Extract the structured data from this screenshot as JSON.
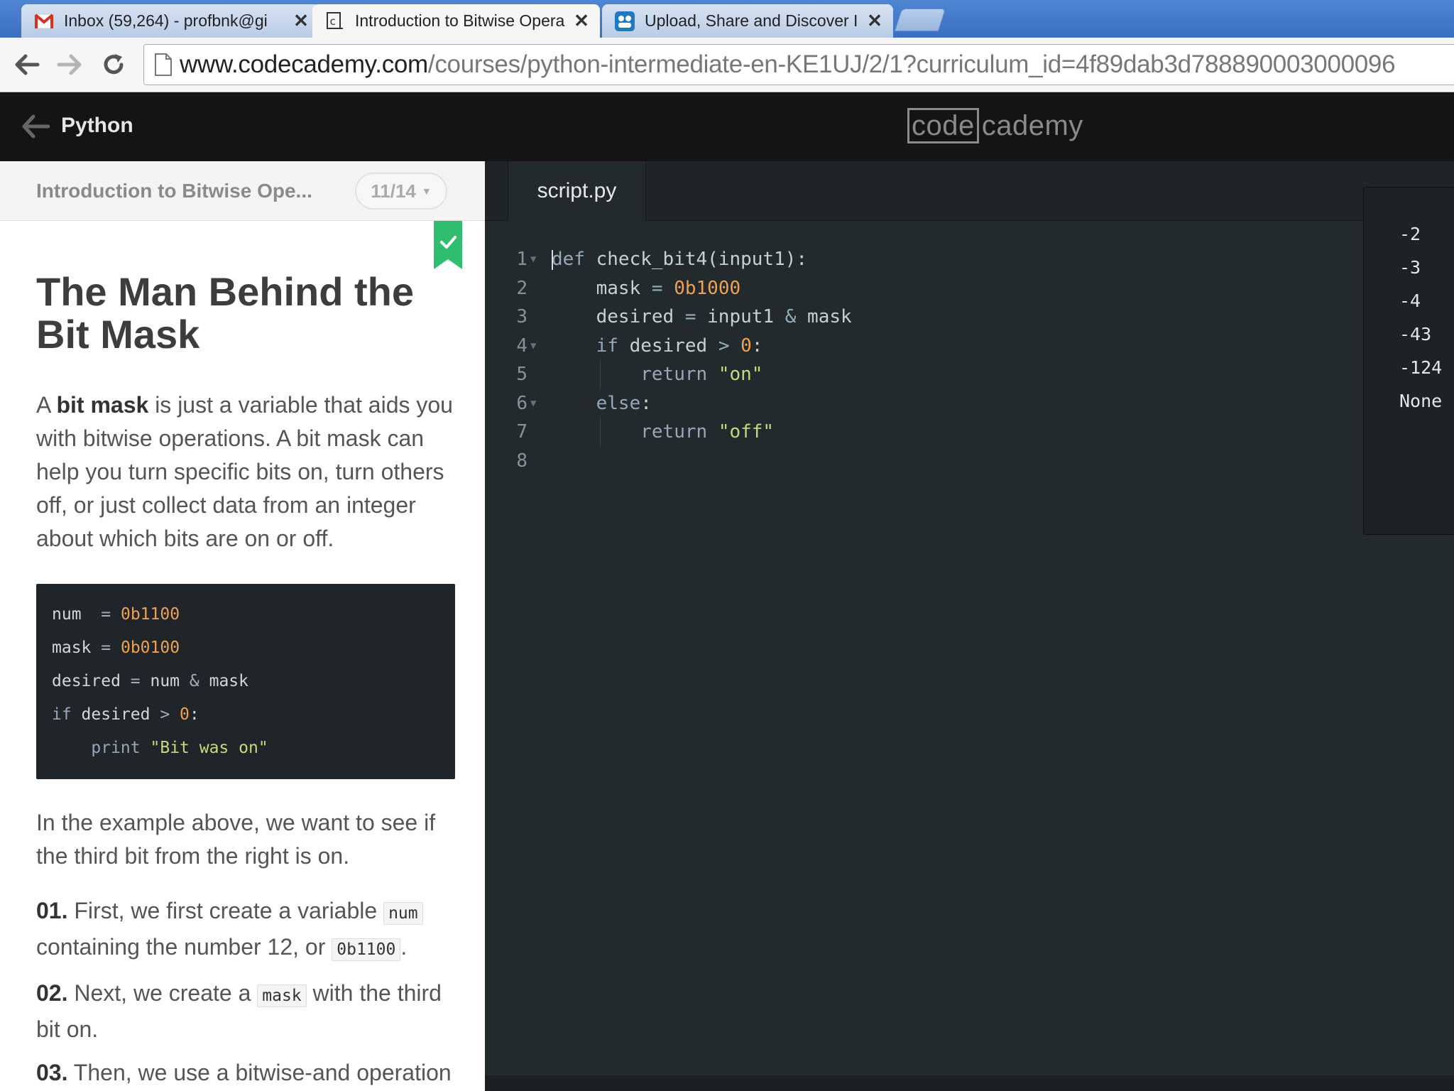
{
  "browser": {
    "tabs": [
      {
        "title": "Inbox (59,264) - profbnk@gi",
        "icon": "gmail-icon"
      },
      {
        "title": "Introduction to Bitwise Opera",
        "icon": "codecademy-favicon",
        "active": true
      },
      {
        "title": "Upload, Share and Discover I",
        "icon": "upload-site-favicon"
      }
    ],
    "close_glyph": "✕",
    "url_host": "www.codecademy.com",
    "url_path": "/courses/python-intermediate-en-KE1UJ/2/1?curriculum_id=4f89dab3d788890003000096"
  },
  "header": {
    "course": "Python",
    "logo_boxed": "code",
    "logo_rest": "cademy"
  },
  "lesson": {
    "title": "Introduction to Bitwise Ope...",
    "progress": "11/14",
    "heading": "The Man Behind the Bit Mask",
    "intro_prefix": "A ",
    "intro_bold": "bit mask",
    "intro_rest": " is just a variable that aids you with bitwise operations. A bit mask can help you turn specific bits on, turn others off, or just collect data from an integer about which bits are on or off.",
    "example": [
      "num  = 0b1100",
      "mask = 0b0100",
      "desired = num & mask",
      "if desired > 0:",
      "    print \"Bit was on\""
    ],
    "explanation": "In the example above, we want to see if the third bit from the right is on.",
    "steps": [
      {
        "num": "01.",
        "text_a": "First, we first create a variable",
        "code_a": "num",
        "text_b": "containing the number 12, or",
        "code_b": "0b1100",
        "text_c": "."
      },
      {
        "num": "02.",
        "text_a": "Next, we create a",
        "code_a": "mask",
        "text_b": "with the third bit on."
      },
      {
        "num": "03.",
        "text_a": "Then, we use a bitwise-and operation to see if the third bit from"
      }
    ]
  },
  "editor": {
    "filename": "script.py",
    "lines": [
      "def check_bit4(input1):",
      "    mask = 0b1000",
      "    desired = input1 & mask",
      "    if desired > 0:",
      "        return \"on\"",
      "    else:",
      "        return \"off\"",
      ""
    ],
    "line_numbers": [
      "1",
      "2",
      "3",
      "4",
      "5",
      "6",
      "7",
      "8"
    ],
    "fold_lines": [
      1,
      4,
      6
    ]
  },
  "output": [
    "-2",
    "-3",
    "-4",
    "-43",
    "-124",
    "None"
  ],
  "colors": {
    "header_bg": "#141414",
    "editor_bg": "#232a2e",
    "number": "#f0a050",
    "string": "#c8d87c",
    "bookmark": "#2fbd6f"
  }
}
